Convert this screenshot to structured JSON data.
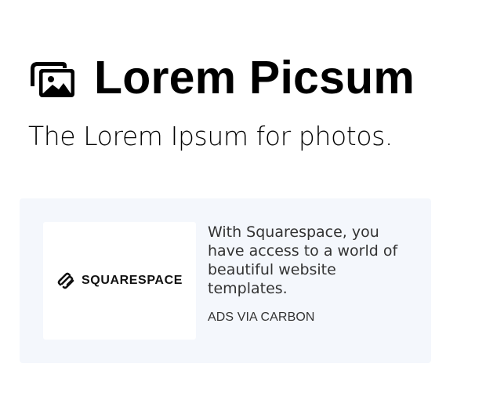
{
  "header": {
    "logo_icon": "photos-icon",
    "title": "Lorem Picsum",
    "tagline": "The Lorem Ipsum for photos."
  },
  "ad": {
    "brand_icon": "squarespace-logo-icon",
    "brand_name": "SQUARESPACE",
    "text": "With Squarespace, you have access to a world of beautiful website templates.",
    "via_label": "ADS VIA CARBON"
  },
  "colors": {
    "page_background": "#ffffff",
    "ad_background": "#f4f7fc",
    "primary_text": "#000000",
    "ad_text": "#333333"
  }
}
